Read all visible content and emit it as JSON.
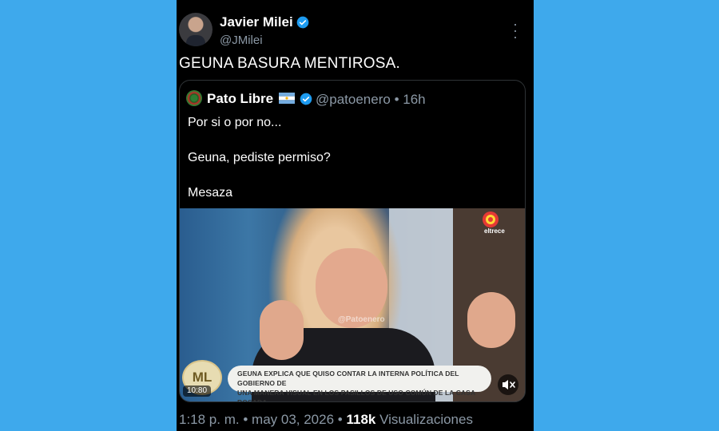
{
  "tweet": {
    "author_name": "Javier Milei",
    "author_handle": "@JMilei",
    "text": "GEUNA BASURA MENTIROSA.",
    "more_icon": "more-dots-icon"
  },
  "quoted": {
    "author_name": "Pato Libre",
    "author_handle": "@patoenero",
    "age": "16h",
    "lines": [
      "Por si o por no...",
      "Geuna, pediste permiso?",
      "Mesaza"
    ],
    "video": {
      "channel_logo": "eltrece",
      "watermark": "@Patoenero",
      "badge": "ML",
      "caption_line1": "GEUNA EXPLICA QUE QUISO CONTAR LA INTERNA POLÍTICA DEL GOBIERNO DE",
      "caption_line2": "UNA MANERA VISUAL EN LOS PASILLOS DE USO COMÚN DE LA CASA ROSADA",
      "timestamp": "10:80"
    }
  },
  "footer": {
    "time": "1:18 p. m.",
    "date": "may 03, 2026",
    "views_count": "118k",
    "views_label": "Visualizaciones"
  },
  "colors": {
    "background": "#3ea9ec",
    "verified": "#1d9bf0"
  }
}
